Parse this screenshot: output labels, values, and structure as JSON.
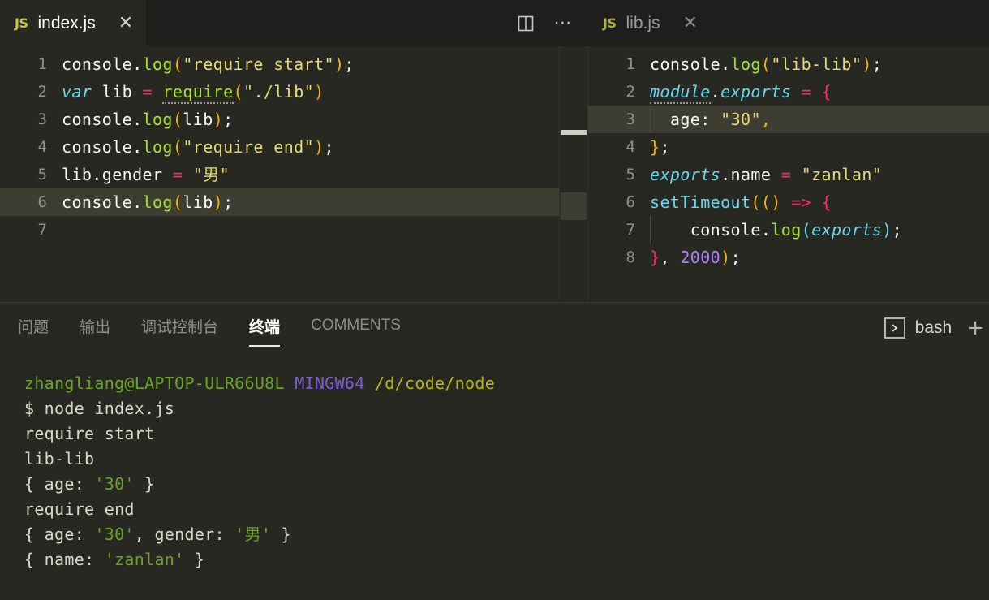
{
  "editors": [
    {
      "tab": {
        "icon": "JS",
        "label": "index.js",
        "close": "✕",
        "state": "active"
      },
      "lines": [
        {
          "num": "1",
          "current": false,
          "tokens": [
            {
              "t": "console",
              "c": "t-plain"
            },
            {
              "t": ".",
              "c": "t-plain"
            },
            {
              "t": "log",
              "c": "t-fn"
            },
            {
              "t": "(",
              "c": "t-punc"
            },
            {
              "t": "\"require start\"",
              "c": "t-str"
            },
            {
              "t": ")",
              "c": "t-punc"
            },
            {
              "t": ";",
              "c": "t-plain"
            }
          ]
        },
        {
          "num": "2",
          "current": false,
          "tokens": [
            {
              "t": "var",
              "c": "t-kw"
            },
            {
              "t": " lib ",
              "c": "t-plain"
            },
            {
              "t": "=",
              "c": "t-op"
            },
            {
              "t": " ",
              "c": "t-plain"
            },
            {
              "t": "require",
              "c": "t-fn",
              "hint": true
            },
            {
              "t": "(",
              "c": "t-punc"
            },
            {
              "t": "\"./lib\"",
              "c": "t-str"
            },
            {
              "t": ")",
              "c": "t-punc"
            }
          ]
        },
        {
          "num": "3",
          "current": false,
          "tokens": [
            {
              "t": "console",
              "c": "t-plain"
            },
            {
              "t": ".",
              "c": "t-plain"
            },
            {
              "t": "log",
              "c": "t-fn"
            },
            {
              "t": "(",
              "c": "t-punc"
            },
            {
              "t": "lib",
              "c": "t-plain"
            },
            {
              "t": ")",
              "c": "t-punc"
            },
            {
              "t": ";",
              "c": "t-plain"
            }
          ]
        },
        {
          "num": "4",
          "current": false,
          "tokens": [
            {
              "t": "console",
              "c": "t-plain"
            },
            {
              "t": ".",
              "c": "t-plain"
            },
            {
              "t": "log",
              "c": "t-fn"
            },
            {
              "t": "(",
              "c": "t-punc"
            },
            {
              "t": "\"require end\"",
              "c": "t-str"
            },
            {
              "t": ")",
              "c": "t-punc"
            },
            {
              "t": ";",
              "c": "t-plain"
            }
          ]
        },
        {
          "num": "5",
          "current": false,
          "tokens": [
            {
              "t": "lib",
              "c": "t-plain"
            },
            {
              "t": ".",
              "c": "t-plain"
            },
            {
              "t": "gender ",
              "c": "t-plain"
            },
            {
              "t": "=",
              "c": "t-op"
            },
            {
              "t": " ",
              "c": "t-plain"
            },
            {
              "t": "\"男\"",
              "c": "t-str"
            }
          ]
        },
        {
          "num": "6",
          "current": true,
          "tokens": [
            {
              "t": "console",
              "c": "t-plain"
            },
            {
              "t": ".",
              "c": "t-plain"
            },
            {
              "t": "log",
              "c": "t-fn"
            },
            {
              "t": "(",
              "c": "t-punc"
            },
            {
              "t": "lib",
              "c": "t-plain"
            },
            {
              "t": ")",
              "c": "t-punc"
            },
            {
              "t": ";",
              "c": "t-plain"
            }
          ]
        },
        {
          "num": "7",
          "current": false,
          "tokens": []
        }
      ]
    },
    {
      "tab": {
        "icon": "JS",
        "label": "lib.js",
        "close": "✕",
        "state": "inactive"
      },
      "lines": [
        {
          "num": "1",
          "current": false,
          "tokens": [
            {
              "t": "console",
              "c": "t-plain"
            },
            {
              "t": ".",
              "c": "t-plain"
            },
            {
              "t": "log",
              "c": "t-fn"
            },
            {
              "t": "(",
              "c": "t-punc"
            },
            {
              "t": "\"lib-lib\"",
              "c": "t-str"
            },
            {
              "t": ")",
              "c": "t-punc"
            },
            {
              "t": ";",
              "c": "t-plain"
            }
          ]
        },
        {
          "num": "2",
          "current": false,
          "tokens": [
            {
              "t": "module",
              "c": "t-var",
              "hint": true
            },
            {
              "t": ".",
              "c": "t-plain"
            },
            {
              "t": "exports",
              "c": "t-var"
            },
            {
              "t": " ",
              "c": "t-plain"
            },
            {
              "t": "=",
              "c": "t-op"
            },
            {
              "t": " ",
              "c": "t-plain"
            },
            {
              "t": "{",
              "c": "t-brace"
            }
          ]
        },
        {
          "num": "3",
          "current": true,
          "tokens": [
            {
              "t": "  age",
              "c": "t-plain"
            },
            {
              "t": ":",
              "c": "t-plain"
            },
            {
              "t": " ",
              "c": "t-plain"
            },
            {
              "t": "\"30\"",
              "c": "t-str"
            },
            {
              "t": ",",
              "c": "t-punc"
            }
          ]
        },
        {
          "num": "4",
          "current": false,
          "tokens": [
            {
              "t": "}",
              "c": "t-punc"
            },
            {
              "t": ";",
              "c": "t-plain"
            }
          ]
        },
        {
          "num": "5",
          "current": false,
          "tokens": [
            {
              "t": "exports",
              "c": "t-var"
            },
            {
              "t": ".",
              "c": "t-plain"
            },
            {
              "t": "name ",
              "c": "t-plain"
            },
            {
              "t": "=",
              "c": "t-op"
            },
            {
              "t": " ",
              "c": "t-plain"
            },
            {
              "t": "\"zanlan\"",
              "c": "t-str"
            }
          ]
        },
        {
          "num": "6",
          "current": false,
          "tokens": [
            {
              "t": "setTimeout",
              "c": "t-cyan"
            },
            {
              "t": "(",
              "c": "t-punc"
            },
            {
              "t": "(",
              "c": "t-punc"
            },
            {
              "t": ")",
              "c": "t-punc"
            },
            {
              "t": " ",
              "c": "t-plain"
            },
            {
              "t": "=>",
              "c": "t-op"
            },
            {
              "t": " ",
              "c": "t-plain"
            },
            {
              "t": "{",
              "c": "t-brace"
            }
          ]
        },
        {
          "num": "7",
          "current": false,
          "tokens": [
            {
              "t": "    console",
              "c": "t-plain"
            },
            {
              "t": ".",
              "c": "t-plain"
            },
            {
              "t": "log",
              "c": "t-fn"
            },
            {
              "t": "(",
              "c": "t-cyan"
            },
            {
              "t": "exports",
              "c": "t-var"
            },
            {
              "t": ")",
              "c": "t-cyan"
            },
            {
              "t": ";",
              "c": "t-plain"
            }
          ]
        },
        {
          "num": "8",
          "current": false,
          "tokens": [
            {
              "t": "}",
              "c": "t-brace"
            },
            {
              "t": ",",
              "c": "t-plain"
            },
            {
              "t": " ",
              "c": "t-plain"
            },
            {
              "t": "2000",
              "c": "t-num"
            },
            {
              "t": ")",
              "c": "t-punc"
            },
            {
              "t": ";",
              "c": "t-plain"
            }
          ]
        }
      ]
    }
  ],
  "editor_actions": {
    "split_icon": "split-editor",
    "more_icon": "more-actions"
  },
  "panel": {
    "tabs": [
      {
        "label": "问题",
        "active": false
      },
      {
        "label": "输出",
        "active": false
      },
      {
        "label": "调试控制台",
        "active": false
      },
      {
        "label": "终端",
        "active": true
      },
      {
        "label": "COMMENTS",
        "active": false
      }
    ],
    "terminal_selector": {
      "icon_glyph": "〉",
      "name": "bash",
      "add_glyph": "+"
    }
  },
  "terminal": {
    "lines": [
      {
        "segments": [
          {
            "t": "zhangliang@LAPTOP-ULR66U8L",
            "c": "c-green"
          },
          {
            "t": " ",
            "c": "c-white"
          },
          {
            "t": "MINGW64",
            "c": "c-violet"
          },
          {
            "t": " ",
            "c": "c-white"
          },
          {
            "t": "/d/code/node",
            "c": "c-yellow"
          }
        ]
      },
      {
        "segments": [
          {
            "t": "$ node index.js",
            "c": "c-white"
          }
        ]
      },
      {
        "segments": [
          {
            "t": "require start",
            "c": "c-white"
          }
        ]
      },
      {
        "segments": [
          {
            "t": "lib-lib",
            "c": "c-white"
          }
        ]
      },
      {
        "segments": [
          {
            "t": "{ age: ",
            "c": "c-white"
          },
          {
            "t": "'30'",
            "c": "c-val"
          },
          {
            "t": " }",
            "c": "c-white"
          }
        ]
      },
      {
        "segments": [
          {
            "t": "require end",
            "c": "c-white"
          }
        ]
      },
      {
        "segments": [
          {
            "t": "{ age: ",
            "c": "c-white"
          },
          {
            "t": "'30'",
            "c": "c-val"
          },
          {
            "t": ", gender: ",
            "c": "c-white"
          },
          {
            "t": "'男'",
            "c": "c-val"
          },
          {
            "t": " }",
            "c": "c-white"
          }
        ]
      },
      {
        "segments": [
          {
            "t": "{ name: ",
            "c": "c-white"
          },
          {
            "t": "'zanlan'",
            "c": "c-val"
          },
          {
            "t": " }",
            "c": "c-white"
          }
        ]
      }
    ]
  },
  "colors": {
    "editor_bg": "#272822",
    "tabbar_bg": "#1e1f1c",
    "current_line": "#3e3d32",
    "accent_string": "#e6db74",
    "accent_function": "#a6e22e",
    "accent_keyword": "#66d9ef",
    "accent_operator": "#f92672",
    "accent_number": "#ae81ff"
  }
}
